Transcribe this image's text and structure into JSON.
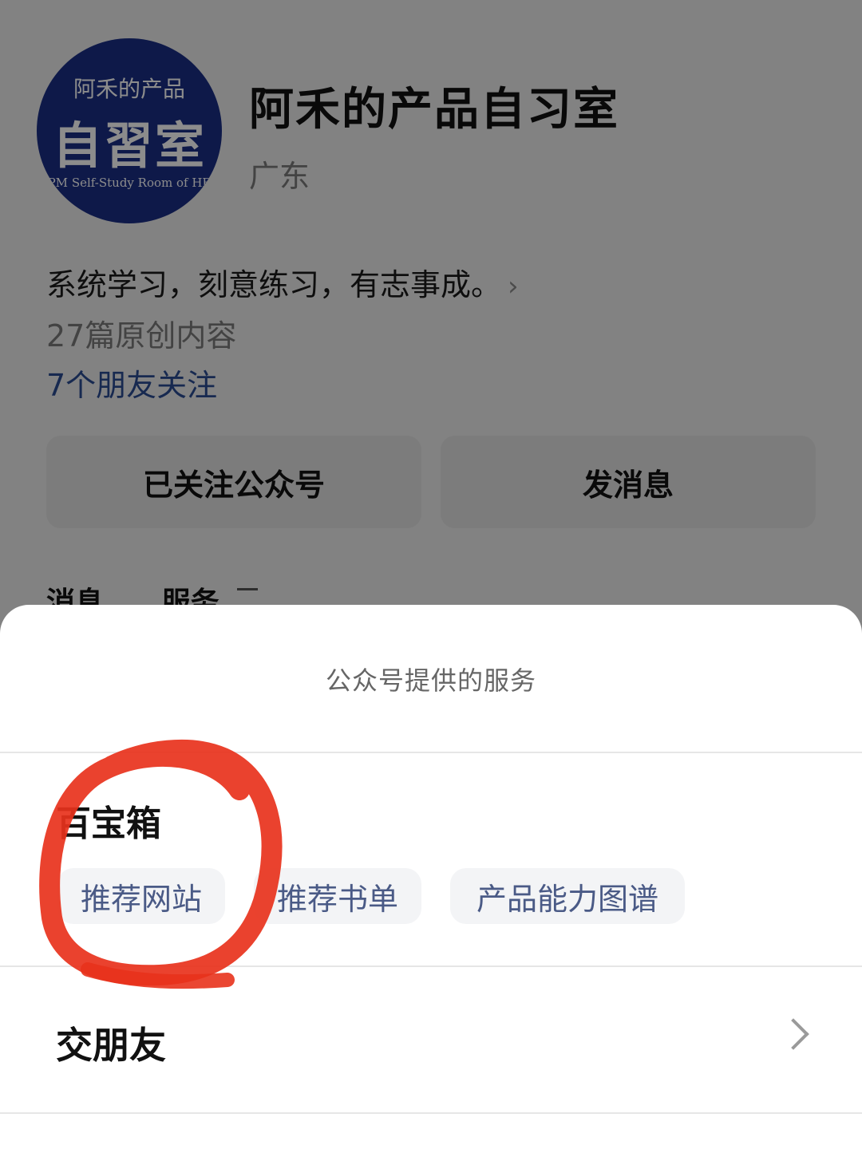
{
  "profile": {
    "avatar": {
      "line1": "阿禾的产品",
      "line2": "自習室",
      "line3": "PM Self-Study Room of HE"
    },
    "name": "阿禾的产品自习室",
    "region": "广东",
    "intro": "系统学习，刻意练习，有志事成。",
    "original_count": "27篇原创内容",
    "friends_following": "7个朋友关注",
    "buttons": {
      "follow": "已关注公众号",
      "message": "发消息"
    },
    "tabs": [
      "消息",
      "服务"
    ]
  },
  "sheet": {
    "title": "公众号提供的服务",
    "group": {
      "title": "百宝箱",
      "chips": [
        "推荐网站",
        "推荐书单",
        "产品能力图谱"
      ]
    },
    "row": {
      "label": "交朋友"
    }
  },
  "colors": {
    "avatar_bg": "#1b2f86",
    "link_blue": "#2a4c92",
    "chip_text": "#4a5a86",
    "annotation_red": "#e8321c"
  }
}
